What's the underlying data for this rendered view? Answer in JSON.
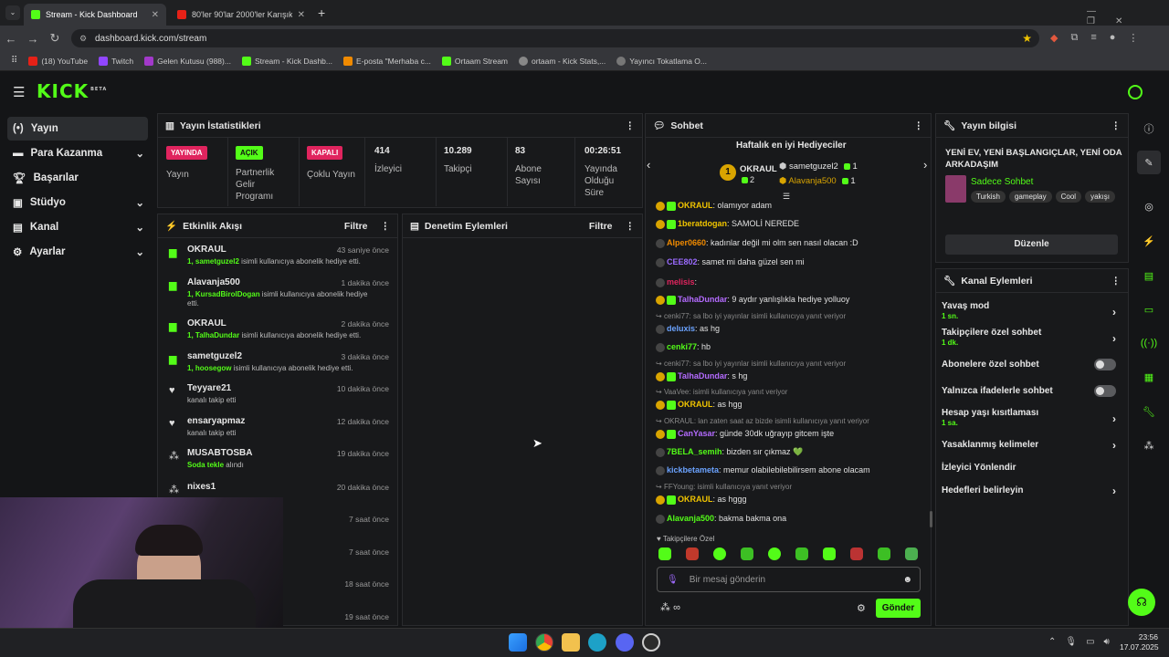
{
  "browser": {
    "tabs": [
      {
        "label": "Stream - Kick Dashboard",
        "active": true
      },
      {
        "label": "80'ler 90'lar 2000'ler Karışık Tür",
        "active": false
      }
    ],
    "new_tab": "+",
    "url": "dashboard.kick.com/stream",
    "bookmarks": [
      "(18) YouTube",
      "Twitch",
      "Gelen Kutusu (988)...",
      "Stream - Kick Dashb...",
      "E-posta \"Merhaba c...",
      "Ortaam Stream",
      "ortaam - Kick Stats,...",
      "Yayıncı Tokatlama O..."
    ]
  },
  "brand": {
    "logo": "KICK",
    "sup": "BETA",
    "accent": "#53fc18"
  },
  "sidebar": {
    "items": [
      {
        "label": "Yayın",
        "icon": "broadcast-icon"
      },
      {
        "label": "Para Kazanma",
        "icon": "money-icon"
      },
      {
        "label": "Başarılar",
        "icon": "trophy-icon"
      },
      {
        "label": "Stüdyo",
        "icon": "studio-icon"
      },
      {
        "label": "Kanal",
        "icon": "channel-icon"
      },
      {
        "label": "Ayarlar",
        "icon": "gear-icon"
      }
    ]
  },
  "stats": {
    "title": "Yayın İstatistikleri",
    "status_badge": "YAYINDA",
    "status_label": "Yayın",
    "partner_badge": "AÇIK",
    "partner_label": "Partnerlik Gelir Programı",
    "multi_badge": "KAPALI",
    "multi_label": "Çoklu Yayın",
    "viewers": "414",
    "viewers_label": "İzleyici",
    "followers": "10.289",
    "followers_label": "Takipçi",
    "subs": "83",
    "subs_label": "Abone Sayısı",
    "duration": "00:26:51",
    "duration_label": "Yayında Olduğu Süre"
  },
  "activity": {
    "title": "Etkinlik Akışı",
    "filter": "Filtre",
    "events": [
      {
        "name": "OKRAUL",
        "time": "43 saniye önce",
        "detail": "1, ",
        "user": "sametguzel2",
        "rest": " isimli kullanıcıya abonelik hediye etti."
      },
      {
        "name": "Alavanja500",
        "time": "1 dakika önce",
        "detail": "1, ",
        "user": "KursadBirolDogan",
        "rest": " isimli kullanıcıya abonelik hediye etti."
      },
      {
        "name": "OKRAUL",
        "time": "2 dakika önce",
        "detail": "1, ",
        "user": "TalhaDundar",
        "rest": " isimli kullanıcıya abonelik hediye etti."
      },
      {
        "name": "sametguzel2",
        "time": "3 dakika önce",
        "detail": "1, ",
        "user": "hoosegow",
        "rest": " isimli kullanıcıya abonelik hediye etti."
      },
      {
        "name": "Teyyare21",
        "time": "10 dakika önce",
        "detail": "kanalı takip etti"
      },
      {
        "name": "ensaryapmaz",
        "time": "12 dakika önce",
        "detail": "kanalı takip etti"
      },
      {
        "name": "MUSABTOSBA",
        "time": "19 dakika önce",
        "user": "Soda tekle",
        "rest": " alındı"
      },
      {
        "name": "nixes1",
        "time": "20 dakika önce"
      },
      {
        "time": "7 saat önce",
        "detail": "alındı"
      },
      {
        "time": "7 saat önce"
      },
      {
        "time": "18 saat önce"
      },
      {
        "time": "19 saat önce"
      }
    ]
  },
  "moderation": {
    "title": "Denetim Eylemleri",
    "filter": "Filtre"
  },
  "chat": {
    "title": "Sohbet",
    "gifters_title": "Haftalık en iyi Hediyeciler",
    "top1": "OKRAUL",
    "top1_count": "2",
    "top2": "sametguzel2",
    "top2_count": "1",
    "top3": "Alavanja500",
    "top3_count": "1",
    "messages": [
      {
        "user": "OKRAUL",
        "text": ": olamıyor adam",
        "color": "#f0c400"
      },
      {
        "user": "1beratdogan",
        "text": ": SAMOLİ NEREDE",
        "color": "#f0c400"
      },
      {
        "user": "Alper0660",
        "text": ": kadınlar değil mi olm sen nasıl olacan :D",
        "color": "#f08a00"
      },
      {
        "user": "CEE802",
        "text": ": samet mi daha güzel sen mi",
        "color": "#9b6bff"
      },
      {
        "user": "melisis",
        "text": ":",
        "color": "#e0245e"
      },
      {
        "user": "TalhaDundar",
        "text": ": 9 aydır yanlışlıkla hediye yolluoy",
        "color": "#b46bff"
      },
      {
        "reply": "cenki77: sa lbo iyi yayınlar isimli kullanıcıya yanıt veriyor"
      },
      {
        "user": "deluxis",
        "text": ": as hg",
        "color": "#6ba3ff"
      },
      {
        "user": "cenki77",
        "text": ": hb",
        "color": "#53fc18"
      },
      {
        "reply": "cenki77: sa lbo iyi yayınlar isimli kullanıcıya yanıt veriyor"
      },
      {
        "user": "TalhaDundar",
        "text": ": s hg",
        "color": "#b46bff"
      },
      {
        "reply": "VaaVee: isimli kullanıcıya yanıt veriyor"
      },
      {
        "user": "OKRAUL",
        "text": ": as hgg",
        "color": "#f0c400"
      },
      {
        "reply": "OKRAUL: lan zaten saat az bizde isimli kullanıcıya yanıt veriyor"
      },
      {
        "user": "CanYasar",
        "text": ": günde 30dk uğrayıp gitcem işte",
        "color": "#b46bff"
      },
      {
        "user": "7BELA_semih",
        "text": ": bizden sır çıkmaz 💚",
        "color": "#53fc18"
      },
      {
        "user": "kickbetameta",
        "text": ": memur olabilebilebilirsem abone olacam",
        "color": "#6ba3ff"
      },
      {
        "reply": "FFYoung: isimli kullanıcıya yanıt veriyor"
      },
      {
        "user": "OKRAUL",
        "text": ": as hggg",
        "color": "#f0c400"
      },
      {
        "user": "Alavanja500",
        "text": ": bakma bakma ona",
        "color": "#53fc18"
      }
    ],
    "followers_only": "Takipçilere Özel",
    "placeholder": "Bir mesaj gönderin",
    "send": "Gönder"
  },
  "stream_info": {
    "title": "Yayın bilgisi",
    "stream_title": "YENİ EV, YENİ BAŞLANGIÇLAR, YENİ ODA ARKADAŞIM",
    "category": "Sadece Sohbet",
    "tags": [
      "Turkish",
      "gameplay",
      "Cool",
      "yakışı"
    ],
    "edit": "Düzenle"
  },
  "channel_actions": {
    "title": "Kanal Eylemleri",
    "items": [
      {
        "label": "Yavaş mod",
        "sub": "1 sn.",
        "kind": "arrow"
      },
      {
        "label": "Takipçilere özel sohbet",
        "sub": "1 dk.",
        "kind": "arrow"
      },
      {
        "label": "Abonelere özel sohbet",
        "kind": "toggle"
      },
      {
        "label": "Yalnızca ifadelerle sohbet",
        "kind": "toggle"
      },
      {
        "label": "Hesap yaşı kısıtlaması",
        "sub": "1 sa.",
        "kind": "arrow"
      },
      {
        "label": "Yasaklanmış kelimeler",
        "kind": "arrow"
      },
      {
        "label": "İzleyici Yönlendir",
        "kind": "none"
      },
      {
        "label": "Hedefleri belirleyin",
        "kind": "arrow"
      }
    ]
  },
  "taskbar": {
    "time": "23:56",
    "date": "17.07.2025"
  }
}
